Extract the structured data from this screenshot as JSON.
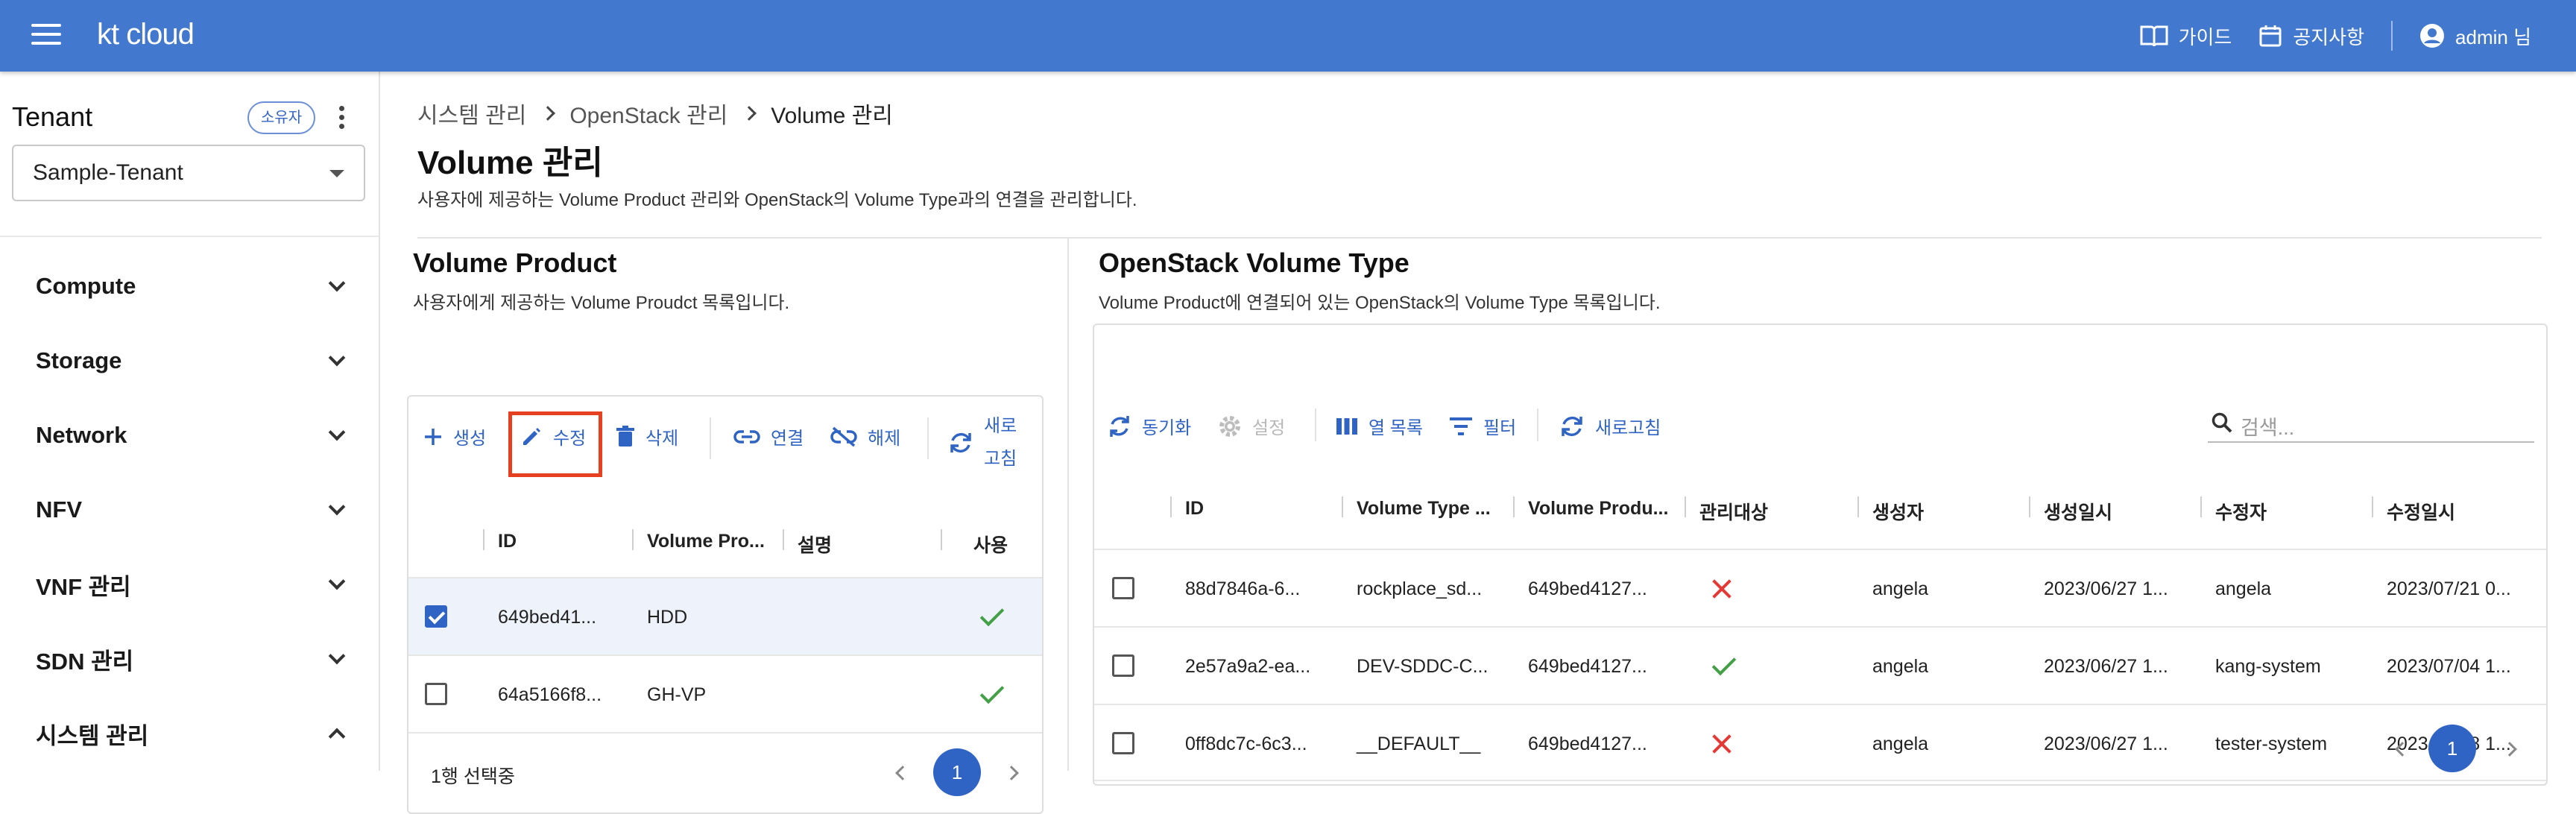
{
  "header": {
    "logo": "kt cloud",
    "guide": "가이드",
    "notice": "공지사항",
    "user": "admin 님"
  },
  "sidebar": {
    "tenant_label": "Tenant",
    "owner_badge": "소유자",
    "tenant_value": "Sample-Tenant",
    "nav": [
      "Compute",
      "Storage",
      "Network",
      "NFV",
      "VNF 관리",
      "SDN 관리",
      "시스템 관리"
    ]
  },
  "breadcrumb": [
    "시스템 관리",
    "OpenStack 관리",
    "Volume 관리"
  ],
  "page": {
    "title": "Volume 관리",
    "desc": "사용자에 제공하는 Volume Product 관리와 OpenStack의 Volume Type과의 연결을 관리합니다."
  },
  "volume_product": {
    "title": "Volume Product",
    "desc": "사용자에게 제공하는 Volume Proudct 목록입니다.",
    "toolbar": {
      "create": "생성",
      "edit": "수정",
      "delete": "삭제",
      "link": "연결",
      "unlink": "해제",
      "refresh_1": "새로",
      "refresh_2": "고침"
    },
    "columns": [
      "ID",
      "Volume Pro...",
      "설명",
      "사용"
    ],
    "rows": [
      {
        "id": "649bed41...",
        "product": "HDD",
        "desc": "",
        "checked": true
      },
      {
        "id": "64a5166f8...",
        "product": "GH-VP",
        "desc": "",
        "checked": false
      }
    ],
    "footer": "1행 선택중",
    "page": "1"
  },
  "volume_type": {
    "title": "OpenStack Volume Type",
    "desc": "Volume Product에 연결되어 있는 OpenStack의 Volume Type 목록입니다.",
    "toolbar": {
      "sync": "동기화",
      "settings": "설정",
      "columns": "열 목록",
      "filter": "필터",
      "refresh": "새로고침"
    },
    "search_placeholder": "검색...",
    "columns": [
      "ID",
      "Volume Type ...",
      "Volume Produ...",
      "관리대상",
      "생성자",
      "생성일시",
      "수정자",
      "수정일시"
    ],
    "rows": [
      {
        "id": "88d7846a-6...",
        "type": "rockplace_sd...",
        "product": "649bed4127...",
        "managed": false,
        "creator": "angela",
        "created": "2023/06/27 1...",
        "modifier": "angela",
        "modified": "2023/07/21 0..."
      },
      {
        "id": "2e57a9a2-ea...",
        "type": "DEV-SDDC-C...",
        "product": "649bed4127...",
        "managed": true,
        "creator": "angela",
        "created": "2023/06/27 1...",
        "modifier": "kang-system",
        "modified": "2023/07/04 1..."
      },
      {
        "id": "0ff8dc7c-6c3...",
        "type": "__DEFAULT__",
        "product": "649bed4127...",
        "managed": false,
        "creator": "angela",
        "created": "2023/06/27 1...",
        "modifier": "tester-system",
        "modified": "2023/06/28 1..."
      }
    ],
    "page": "1"
  },
  "colors": {
    "header": "#4279cf",
    "accent": "#2f64c4",
    "highlight": "#e5401f",
    "ok": "#43a047",
    "no": "#e53935"
  }
}
